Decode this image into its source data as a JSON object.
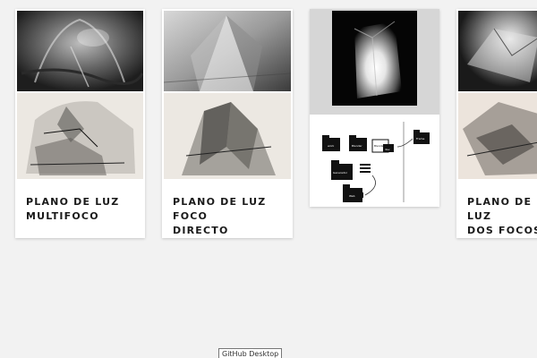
{
  "cards": [
    {
      "title_line1": "PLANO DE LUZ",
      "title_line2": "MULTIFOCO"
    },
    {
      "title_line1": "PLANO DE LUZ FOCO",
      "title_line2": "DIRECTO"
    },
    {
      "diagram_labels": [
        "work",
        "Blender",
        "Blender",
        "dev",
        "Frame",
        "Generador",
        "Web"
      ]
    },
    {
      "title_line1": "PLANO DE LUZ",
      "title_line2": "DOS FOCOS"
    }
  ],
  "tooltip": {
    "text": "GitHub Desktop"
  },
  "colors": {
    "background": "#f2f2f2",
    "card": "#ffffff",
    "title": "#1a1a1a"
  }
}
